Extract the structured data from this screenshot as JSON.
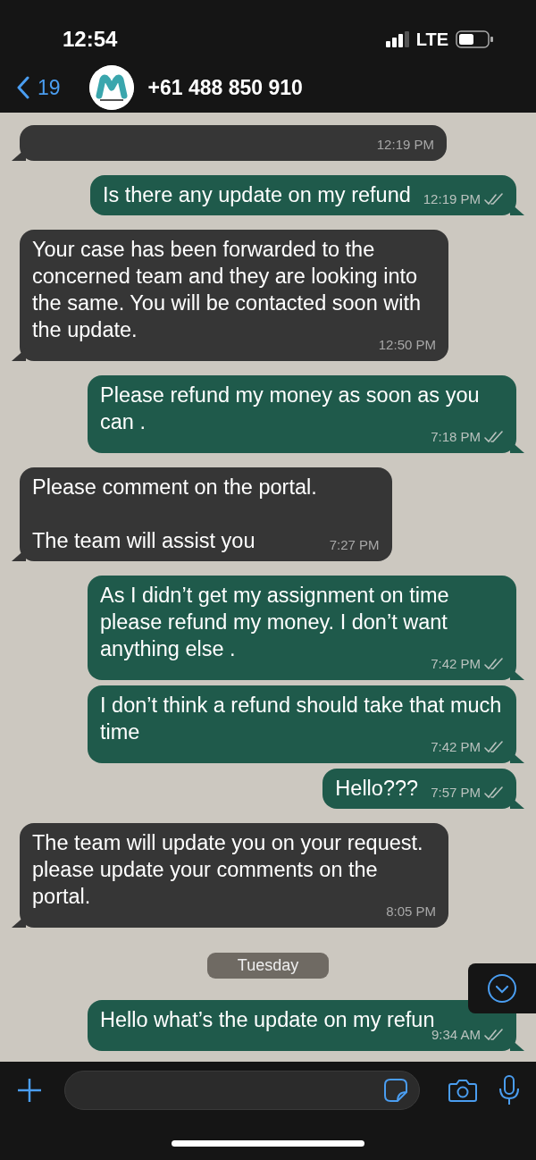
{
  "status_bar": {
    "time": "12:54",
    "network": "LTE"
  },
  "header": {
    "back_count": "19",
    "contact": "+61 488 850 910"
  },
  "messages": [
    {
      "kind": "incoming",
      "time": "12:19 PM"
    },
    {
      "kind": "outgoing",
      "text": "Is there any update on my refund",
      "time": "12:19 PM"
    },
    {
      "kind": "incoming",
      "text": "Your case has been forwarded to the concerned team and they are looking into the same. You will be contacted soon with the update.",
      "time": "12:50 PM"
    },
    {
      "kind": "outgoing",
      "text": "Please refund my money as soon as you can .",
      "time": "7:18 PM"
    },
    {
      "kind": "incoming",
      "text": "Please comment on the portal.\n\nThe team will assist you",
      "time": "7:27 PM"
    },
    {
      "kind": "outgoing",
      "text": "As I didn’t get my assignment on time please refund my money.  I don’t want anything else .",
      "time": "7:42 PM"
    },
    {
      "kind": "outgoing",
      "text": "I don’t think a refund should take that much time",
      "time": "7:42 PM"
    },
    {
      "kind": "outgoing",
      "text": "Hello???",
      "time": "7:57 PM"
    },
    {
      "kind": "incoming",
      "text": "The team will update you on your request. please update your comments on the portal.",
      "time": "8:05 PM"
    },
    {
      "kind": "date",
      "text": "Tuesday"
    },
    {
      "kind": "outgoing",
      "text": "Hello what’s the update on my refun",
      "time": "9:34 AM"
    }
  ]
}
